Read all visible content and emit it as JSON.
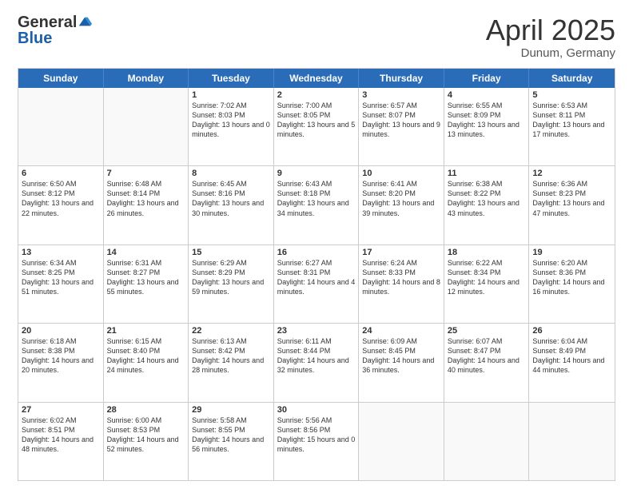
{
  "header": {
    "logo_general": "General",
    "logo_blue": "Blue",
    "title": "April 2025",
    "location": "Dunum, Germany"
  },
  "days_of_week": [
    "Sunday",
    "Monday",
    "Tuesday",
    "Wednesday",
    "Thursday",
    "Friday",
    "Saturday"
  ],
  "weeks": [
    [
      {
        "day": "",
        "info": ""
      },
      {
        "day": "",
        "info": ""
      },
      {
        "day": "1",
        "info": "Sunrise: 7:02 AM\nSunset: 8:03 PM\nDaylight: 13 hours and 0 minutes."
      },
      {
        "day": "2",
        "info": "Sunrise: 7:00 AM\nSunset: 8:05 PM\nDaylight: 13 hours and 5 minutes."
      },
      {
        "day": "3",
        "info": "Sunrise: 6:57 AM\nSunset: 8:07 PM\nDaylight: 13 hours and 9 minutes."
      },
      {
        "day": "4",
        "info": "Sunrise: 6:55 AM\nSunset: 8:09 PM\nDaylight: 13 hours and 13 minutes."
      },
      {
        "day": "5",
        "info": "Sunrise: 6:53 AM\nSunset: 8:11 PM\nDaylight: 13 hours and 17 minutes."
      }
    ],
    [
      {
        "day": "6",
        "info": "Sunrise: 6:50 AM\nSunset: 8:12 PM\nDaylight: 13 hours and 22 minutes."
      },
      {
        "day": "7",
        "info": "Sunrise: 6:48 AM\nSunset: 8:14 PM\nDaylight: 13 hours and 26 minutes."
      },
      {
        "day": "8",
        "info": "Sunrise: 6:45 AM\nSunset: 8:16 PM\nDaylight: 13 hours and 30 minutes."
      },
      {
        "day": "9",
        "info": "Sunrise: 6:43 AM\nSunset: 8:18 PM\nDaylight: 13 hours and 34 minutes."
      },
      {
        "day": "10",
        "info": "Sunrise: 6:41 AM\nSunset: 8:20 PM\nDaylight: 13 hours and 39 minutes."
      },
      {
        "day": "11",
        "info": "Sunrise: 6:38 AM\nSunset: 8:22 PM\nDaylight: 13 hours and 43 minutes."
      },
      {
        "day": "12",
        "info": "Sunrise: 6:36 AM\nSunset: 8:23 PM\nDaylight: 13 hours and 47 minutes."
      }
    ],
    [
      {
        "day": "13",
        "info": "Sunrise: 6:34 AM\nSunset: 8:25 PM\nDaylight: 13 hours and 51 minutes."
      },
      {
        "day": "14",
        "info": "Sunrise: 6:31 AM\nSunset: 8:27 PM\nDaylight: 13 hours and 55 minutes."
      },
      {
        "day": "15",
        "info": "Sunrise: 6:29 AM\nSunset: 8:29 PM\nDaylight: 13 hours and 59 minutes."
      },
      {
        "day": "16",
        "info": "Sunrise: 6:27 AM\nSunset: 8:31 PM\nDaylight: 14 hours and 4 minutes."
      },
      {
        "day": "17",
        "info": "Sunrise: 6:24 AM\nSunset: 8:33 PM\nDaylight: 14 hours and 8 minutes."
      },
      {
        "day": "18",
        "info": "Sunrise: 6:22 AM\nSunset: 8:34 PM\nDaylight: 14 hours and 12 minutes."
      },
      {
        "day": "19",
        "info": "Sunrise: 6:20 AM\nSunset: 8:36 PM\nDaylight: 14 hours and 16 minutes."
      }
    ],
    [
      {
        "day": "20",
        "info": "Sunrise: 6:18 AM\nSunset: 8:38 PM\nDaylight: 14 hours and 20 minutes."
      },
      {
        "day": "21",
        "info": "Sunrise: 6:15 AM\nSunset: 8:40 PM\nDaylight: 14 hours and 24 minutes."
      },
      {
        "day": "22",
        "info": "Sunrise: 6:13 AM\nSunset: 8:42 PM\nDaylight: 14 hours and 28 minutes."
      },
      {
        "day": "23",
        "info": "Sunrise: 6:11 AM\nSunset: 8:44 PM\nDaylight: 14 hours and 32 minutes."
      },
      {
        "day": "24",
        "info": "Sunrise: 6:09 AM\nSunset: 8:45 PM\nDaylight: 14 hours and 36 minutes."
      },
      {
        "day": "25",
        "info": "Sunrise: 6:07 AM\nSunset: 8:47 PM\nDaylight: 14 hours and 40 minutes."
      },
      {
        "day": "26",
        "info": "Sunrise: 6:04 AM\nSunset: 8:49 PM\nDaylight: 14 hours and 44 minutes."
      }
    ],
    [
      {
        "day": "27",
        "info": "Sunrise: 6:02 AM\nSunset: 8:51 PM\nDaylight: 14 hours and 48 minutes."
      },
      {
        "day": "28",
        "info": "Sunrise: 6:00 AM\nSunset: 8:53 PM\nDaylight: 14 hours and 52 minutes."
      },
      {
        "day": "29",
        "info": "Sunrise: 5:58 AM\nSunset: 8:55 PM\nDaylight: 14 hours and 56 minutes."
      },
      {
        "day": "30",
        "info": "Sunrise: 5:56 AM\nSunset: 8:56 PM\nDaylight: 15 hours and 0 minutes."
      },
      {
        "day": "",
        "info": ""
      },
      {
        "day": "",
        "info": ""
      },
      {
        "day": "",
        "info": ""
      }
    ]
  ]
}
